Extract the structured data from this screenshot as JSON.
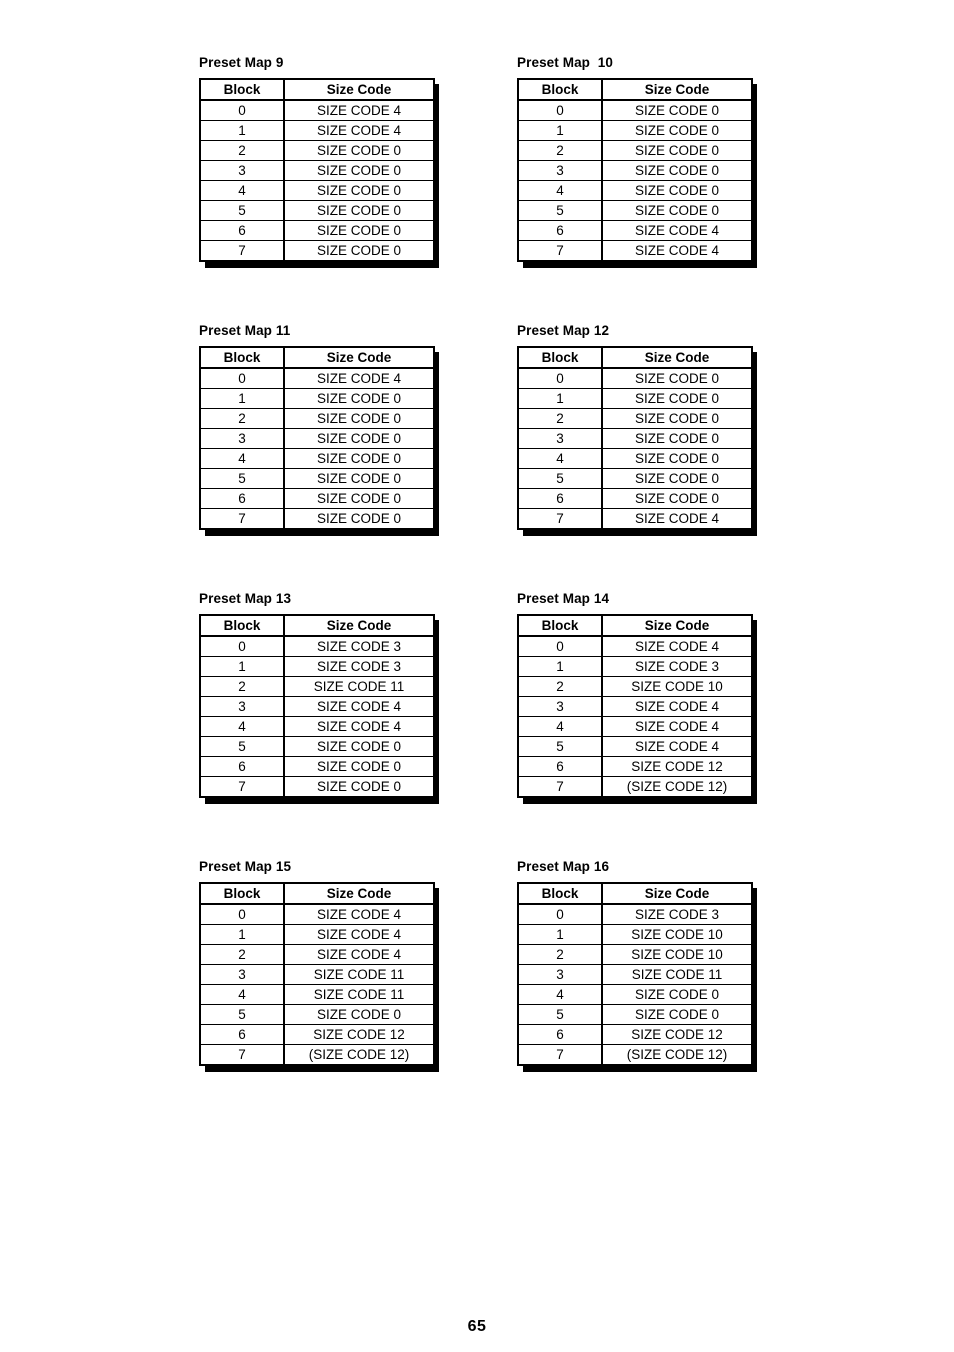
{
  "document": {
    "page_number": "65",
    "column_headers": [
      "Block",
      "Size Code"
    ]
  },
  "tables": [
    {
      "title": "Preset Map 9",
      "rows": [
        {
          "block": "0",
          "size_code": "SIZE CODE 4"
        },
        {
          "block": "1",
          "size_code": "SIZE CODE 4"
        },
        {
          "block": "2",
          "size_code": "SIZE CODE 0"
        },
        {
          "block": "3",
          "size_code": "SIZE CODE 0"
        },
        {
          "block": "4",
          "size_code": "SIZE CODE 0"
        },
        {
          "block": "5",
          "size_code": "SIZE CODE 0"
        },
        {
          "block": "6",
          "size_code": "SIZE CODE 0"
        },
        {
          "block": "7",
          "size_code": "SIZE CODE 0"
        }
      ]
    },
    {
      "title": "Preset Map  10",
      "rows": [
        {
          "block": "0",
          "size_code": "SIZE CODE 0"
        },
        {
          "block": "1",
          "size_code": "SIZE CODE 0"
        },
        {
          "block": "2",
          "size_code": "SIZE CODE 0"
        },
        {
          "block": "3",
          "size_code": "SIZE CODE 0"
        },
        {
          "block": "4",
          "size_code": "SIZE CODE 0"
        },
        {
          "block": "5",
          "size_code": "SIZE CODE 0"
        },
        {
          "block": "6",
          "size_code": "SIZE CODE 4"
        },
        {
          "block": "7",
          "size_code": "SIZE CODE 4"
        }
      ]
    },
    {
      "title": "Preset Map 11",
      "rows": [
        {
          "block": "0",
          "size_code": "SIZE CODE 4"
        },
        {
          "block": "1",
          "size_code": "SIZE CODE 0"
        },
        {
          "block": "2",
          "size_code": "SIZE CODE 0"
        },
        {
          "block": "3",
          "size_code": "SIZE CODE 0"
        },
        {
          "block": "4",
          "size_code": "SIZE CODE 0"
        },
        {
          "block": "5",
          "size_code": "SIZE CODE 0"
        },
        {
          "block": "6",
          "size_code": "SIZE CODE 0"
        },
        {
          "block": "7",
          "size_code": "SIZE CODE 0"
        }
      ]
    },
    {
      "title": "Preset Map 12",
      "rows": [
        {
          "block": "0",
          "size_code": "SIZE CODE 0"
        },
        {
          "block": "1",
          "size_code": "SIZE CODE 0"
        },
        {
          "block": "2",
          "size_code": "SIZE CODE 0"
        },
        {
          "block": "3",
          "size_code": "SIZE CODE 0"
        },
        {
          "block": "4",
          "size_code": "SIZE CODE 0"
        },
        {
          "block": "5",
          "size_code": "SIZE CODE 0"
        },
        {
          "block": "6",
          "size_code": "SIZE CODE 0"
        },
        {
          "block": "7",
          "size_code": "SIZE CODE 4"
        }
      ]
    },
    {
      "title": "Preset Map 13",
      "rows": [
        {
          "block": "0",
          "size_code": "SIZE CODE 3"
        },
        {
          "block": "1",
          "size_code": "SIZE CODE 3"
        },
        {
          "block": "2",
          "size_code": "SIZE CODE 11"
        },
        {
          "block": "3",
          "size_code": "SIZE CODE 4"
        },
        {
          "block": "4",
          "size_code": "SIZE CODE 4"
        },
        {
          "block": "5",
          "size_code": "SIZE CODE 0"
        },
        {
          "block": "6",
          "size_code": "SIZE CODE 0"
        },
        {
          "block": "7",
          "size_code": "SIZE CODE 0"
        }
      ]
    },
    {
      "title": "Preset Map 14",
      "rows": [
        {
          "block": "0",
          "size_code": "SIZE CODE 4"
        },
        {
          "block": "1",
          "size_code": "SIZE CODE 3"
        },
        {
          "block": "2",
          "size_code": "SIZE CODE 10"
        },
        {
          "block": "3",
          "size_code": "SIZE CODE 4"
        },
        {
          "block": "4",
          "size_code": "SIZE CODE 4"
        },
        {
          "block": "5",
          "size_code": "SIZE CODE 4"
        },
        {
          "block": "6",
          "size_code": "SIZE CODE 12"
        },
        {
          "block": "7",
          "size_code": "(SIZE CODE 12)"
        }
      ]
    },
    {
      "title": "Preset Map 15",
      "rows": [
        {
          "block": "0",
          "size_code": "SIZE CODE 4"
        },
        {
          "block": "1",
          "size_code": "SIZE CODE 4"
        },
        {
          "block": "2",
          "size_code": "SIZE CODE 4"
        },
        {
          "block": "3",
          "size_code": "SIZE CODE 11"
        },
        {
          "block": "4",
          "size_code": "SIZE CODE 11"
        },
        {
          "block": "5",
          "size_code": "SIZE CODE 0"
        },
        {
          "block": "6",
          "size_code": "SIZE CODE 12"
        },
        {
          "block": "7",
          "size_code": "(SIZE CODE 12)"
        }
      ]
    },
    {
      "title": "Preset Map 16",
      "rows": [
        {
          "block": "0",
          "size_code": "SIZE CODE 3"
        },
        {
          "block": "1",
          "size_code": "SIZE CODE 10"
        },
        {
          "block": "2",
          "size_code": "SIZE CODE 10"
        },
        {
          "block": "3",
          "size_code": "SIZE CODE 11"
        },
        {
          "block": "4",
          "size_code": "SIZE CODE 0"
        },
        {
          "block": "5",
          "size_code": "SIZE CODE 0"
        },
        {
          "block": "6",
          "size_code": "SIZE CODE 12"
        },
        {
          "block": "7",
          "size_code": "(SIZE CODE 12)"
        }
      ]
    }
  ]
}
